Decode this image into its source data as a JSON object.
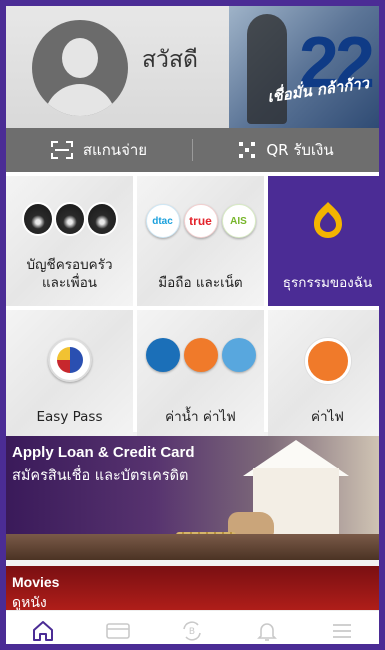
{
  "header": {
    "greeting": "สวัสดี",
    "hero_number": "22",
    "hero_slogan": "เชื่อมั่น กล้าก้าว"
  },
  "actions": {
    "scan_pay": "สแกนจ่าย",
    "qr_receive": "QR รับเงิน"
  },
  "tiles": [
    {
      "label": "บัญชีครอบครัว\nและเพื่อน"
    },
    {
      "label": "มือถือ และเน็ต",
      "badges": [
        "dtac",
        "true",
        "AIS"
      ]
    },
    {
      "label": "ธุรกรรมของฉัน"
    },
    {
      "label": "Easy Pass"
    },
    {
      "label": "ค่าน้ำ ค่าไฟ"
    },
    {
      "label": "ค่าไฟ"
    }
  ],
  "banners": {
    "loan_en": "Apply Loan & Credit Card",
    "loan_th": "สมัครสินเชื่อ และบัตรเครดิต",
    "movies_en": "Movies",
    "movies_th": "ดูหนัง"
  },
  "bottom_nav": [
    "home-icon",
    "card-icon",
    "transfer-icon",
    "bell-icon",
    "menu-icon"
  ],
  "colors": {
    "brand_purple": "#4b2c95",
    "gold": "#f3b400",
    "action_bar": "#6e6e6e"
  }
}
